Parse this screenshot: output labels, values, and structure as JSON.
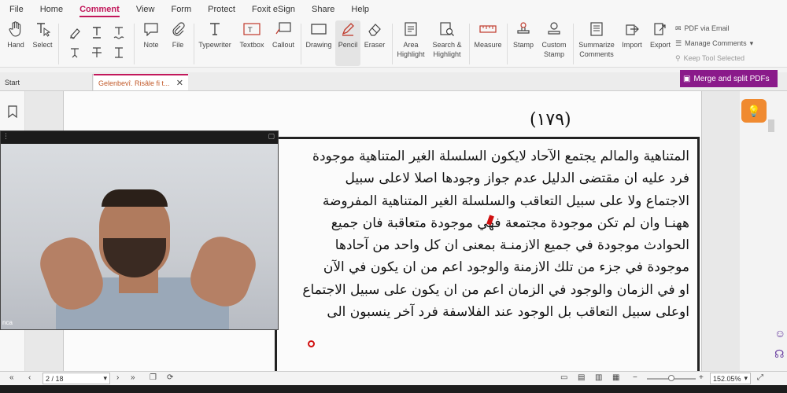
{
  "menu": [
    "File",
    "Home",
    "Comment",
    "View",
    "Form",
    "Protect",
    "Foxit eSign",
    "Share",
    "Help"
  ],
  "active_menu": "Comment",
  "ribbon": {
    "hand": "Hand",
    "select": "Select",
    "note": "Note",
    "file": "File",
    "typewriter": "Typewriter",
    "textbox": "Textbox",
    "callout": "Callout",
    "drawing": "Drawing",
    "pencil": "Pencil",
    "eraser": "Eraser",
    "area_highlight_1": "Area",
    "area_highlight_2": "Highlight",
    "search_highlight_1": "Search &",
    "search_highlight_2": "Highlight",
    "measure": "Measure",
    "stamp": "Stamp",
    "custom_stamp_1": "Custom",
    "custom_stamp_2": "Stamp",
    "summarize_1": "Summarize",
    "summarize_2": "Comments",
    "import": "Import",
    "export": "Export",
    "pdf_via_email": "PDF via Email",
    "manage_comments": "Manage Comments",
    "keep_tool_selected": "Keep Tool Selected"
  },
  "tabs": {
    "start": "Start",
    "document": "Gelenbevî. Risâle fi t..."
  },
  "merge_button": "Merge and split PDFs",
  "page_number_label": "(١٧٩)",
  "arabic_lines": [
    "المتناهية والمالم يجتمع الآحاد لايكون السلسلة الغير المتناهية موجودة",
    "فرد عليه ان مقتضى الدليل عدم جواز وجودها اصلا لاعلى سبيل",
    "الاجتماع ولا على سبيل التعاقب والسلسلة الغير المتناهية المفروضة",
    "ههنـا وان لم تكن موجودة مجتمعة فهي موجودة متعاقبة فان جميع",
    "الحوادث موجودة في جميع الازمنـة بمعنى ان كل واحد من آحادها",
    "موجودة في جزء من تلك الازمنة والوجود اعم من ان يكون في الآن",
    "او في الزمان والوجود في الزمان اعم من ان يكون على سبيل الاجتماع",
    "اوعلى سبيل التعاقب بل الوجود عند الفلاسفة فرد آخر ينسبون الى"
  ],
  "status": {
    "page_indicator": "2 / 18",
    "zoom": "152.05%",
    "zoom_fraction": 0.5
  },
  "video_label": "nca"
}
